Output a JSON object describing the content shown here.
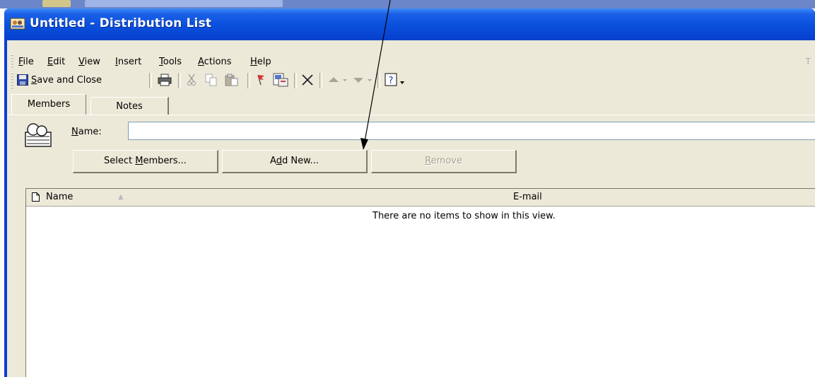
{
  "window": {
    "title": "Untitled - Distribution List"
  },
  "menu": {
    "items": [
      {
        "pre": "",
        "key": "F",
        "post": "ile"
      },
      {
        "pre": "",
        "key": "E",
        "post": "dit"
      },
      {
        "pre": "",
        "key": "V",
        "post": "iew"
      },
      {
        "pre": "",
        "key": "I",
        "post": "nsert"
      },
      {
        "pre": "",
        "key": "T",
        "post": "ools"
      },
      {
        "pre": "",
        "key": "A",
        "post": "ctions"
      },
      {
        "pre": "",
        "key": "H",
        "post": "elp"
      }
    ],
    "right_fragment": "T"
  },
  "toolbar": {
    "save_close_pre": "",
    "save_close_key": "S",
    "save_close_post": "ave and Close",
    "icons": [
      "print-icon",
      "cut-icon",
      "copy-icon",
      "paste-icon",
      "flag-icon",
      "address-book-icon",
      "delete-icon",
      "up-arrow-icon",
      "down-arrow-icon",
      "help-icon"
    ]
  },
  "tabs": [
    {
      "label": "Members",
      "active": true
    },
    {
      "label": "Notes",
      "active": false
    }
  ],
  "name_field": {
    "label_key": "N",
    "label_post": "ame:",
    "value": ""
  },
  "buttons": {
    "select_members": {
      "pre": "Select ",
      "key": "M",
      "post": "embers..."
    },
    "add_new": {
      "pre": "A",
      "key": "d",
      "post": "d New..."
    },
    "remove": {
      "pre": "",
      "key": "R",
      "post": "emove",
      "disabled": true
    }
  },
  "list": {
    "columns": [
      "Name",
      "E-mail"
    ],
    "empty_message": "There are no items to show in this view."
  },
  "colors": {
    "title_bar": "#0a4fdc",
    "face": "#ece9d8"
  }
}
